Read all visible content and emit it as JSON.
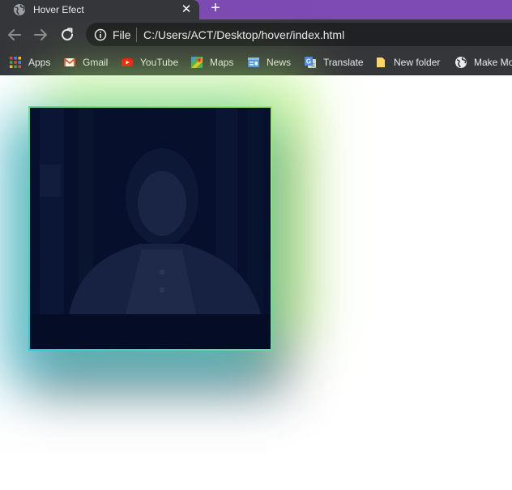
{
  "tab": {
    "title": "Hover Efect",
    "close_glyph": "✕",
    "favicon": "globe-icon"
  },
  "new_tab_glyph": "+",
  "toolbar": {
    "back": "arrow-left-icon",
    "forward": "arrow-right-icon",
    "reload": "reload-icon",
    "scheme_label": "File",
    "url": "C:/Users/ACT/Desktop/hover/index.html"
  },
  "bookmarks": [
    {
      "label": "Apps",
      "icon": "apps-grid-icon"
    },
    {
      "label": "Gmail",
      "icon": "gmail-icon"
    },
    {
      "label": "YouTube",
      "icon": "youtube-icon"
    },
    {
      "label": "Maps",
      "icon": "maps-icon"
    },
    {
      "label": "News",
      "icon": "news-icon"
    },
    {
      "label": "Translate",
      "icon": "translate-icon"
    },
    {
      "label": "New folder",
      "icon": "folder-icon"
    },
    {
      "label": "Make Mo",
      "icon": "globe-icon"
    }
  ],
  "colors": {
    "tabstrip": "#7d4bb3",
    "toolbar": "#35363a",
    "omnibox": "#202124",
    "card_bg": "#060f2c",
    "glow_cyan": "#2ec8d8",
    "glow_green": "#9ef05a"
  }
}
